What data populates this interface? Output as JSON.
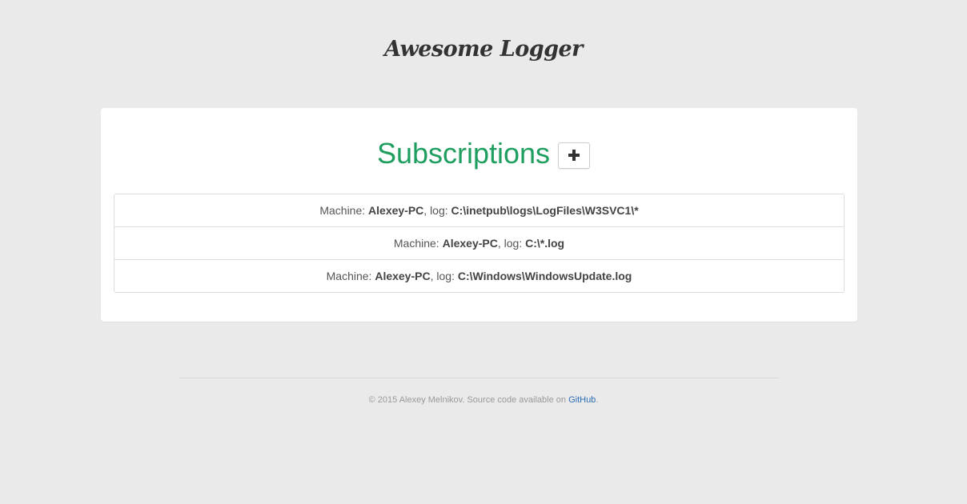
{
  "app": {
    "brand": "Awesome Logger"
  },
  "subscriptions": {
    "title": "Subscriptions",
    "add_button_icon": "plus-icon",
    "machine_label": "Machine: ",
    "log_label": ", log: ",
    "items": [
      {
        "machine": "Alexey-PC",
        "log": "C:\\inetpub\\logs\\LogFiles\\W3SVC1\\*"
      },
      {
        "machine": "Alexey-PC",
        "log": "C:\\*.log"
      },
      {
        "machine": "Alexey-PC",
        "log": "C:\\Windows\\WindowsUpdate.log"
      }
    ]
  },
  "footer": {
    "copyright": "© 2015 Alexey Melnikov. Source code available on ",
    "link_text": "GitHub",
    "suffix": "."
  },
  "colors": {
    "background": "#eaeaea",
    "panel": "#ffffff",
    "title": "#1e9e5f",
    "link": "#2a6cb5"
  }
}
